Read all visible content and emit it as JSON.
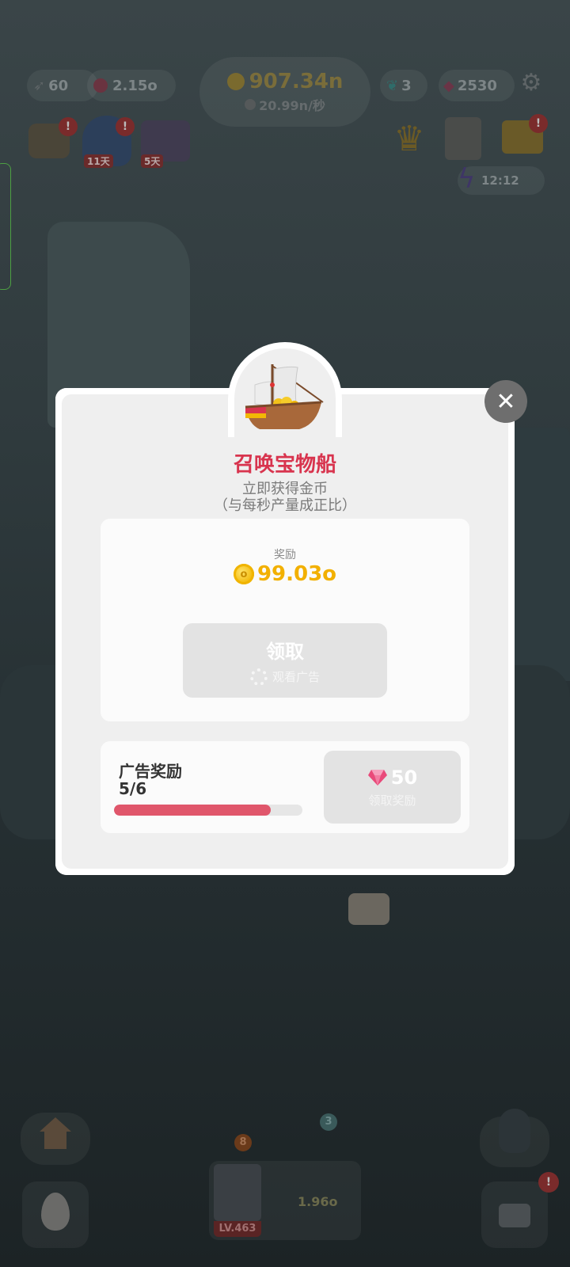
{
  "hud": {
    "lightning_count": "60",
    "energy_value": "2.15o",
    "coin_total": "907.34n",
    "coin_rate": "20.99n/秒",
    "feather_count": "3",
    "gem_count": "2530",
    "timer": "12:12",
    "bag_badge_days": "11天",
    "chest_badge_days": "5天",
    "alert_mark": "!"
  },
  "bottom_bar": {
    "notification_count": "3",
    "level_badge": "8",
    "unit_level": "LV.463",
    "unit_rate": "1.96o"
  },
  "modal": {
    "title": "召唤宝物船",
    "subtitle_line1": "立即获得金币",
    "subtitle_line2": "（与每秒产量成正比）",
    "reward_label": "奖励",
    "coin_glyph": "o",
    "reward_amount": "99.03o",
    "claim_label": "领取",
    "claim_sub": "观看广告",
    "close_glyph": "✕"
  },
  "ad_reward": {
    "title": "广告奖励",
    "progress_text": "5/6",
    "progress_value": 0.8333,
    "gem_amount": "50",
    "button_sub": "领取奖励"
  },
  "colors": {
    "title_red": "#d8344e",
    "coin_gold": "#f2b000",
    "progress_red": "#e0566b",
    "gem_pink": "#e94a7a"
  }
}
